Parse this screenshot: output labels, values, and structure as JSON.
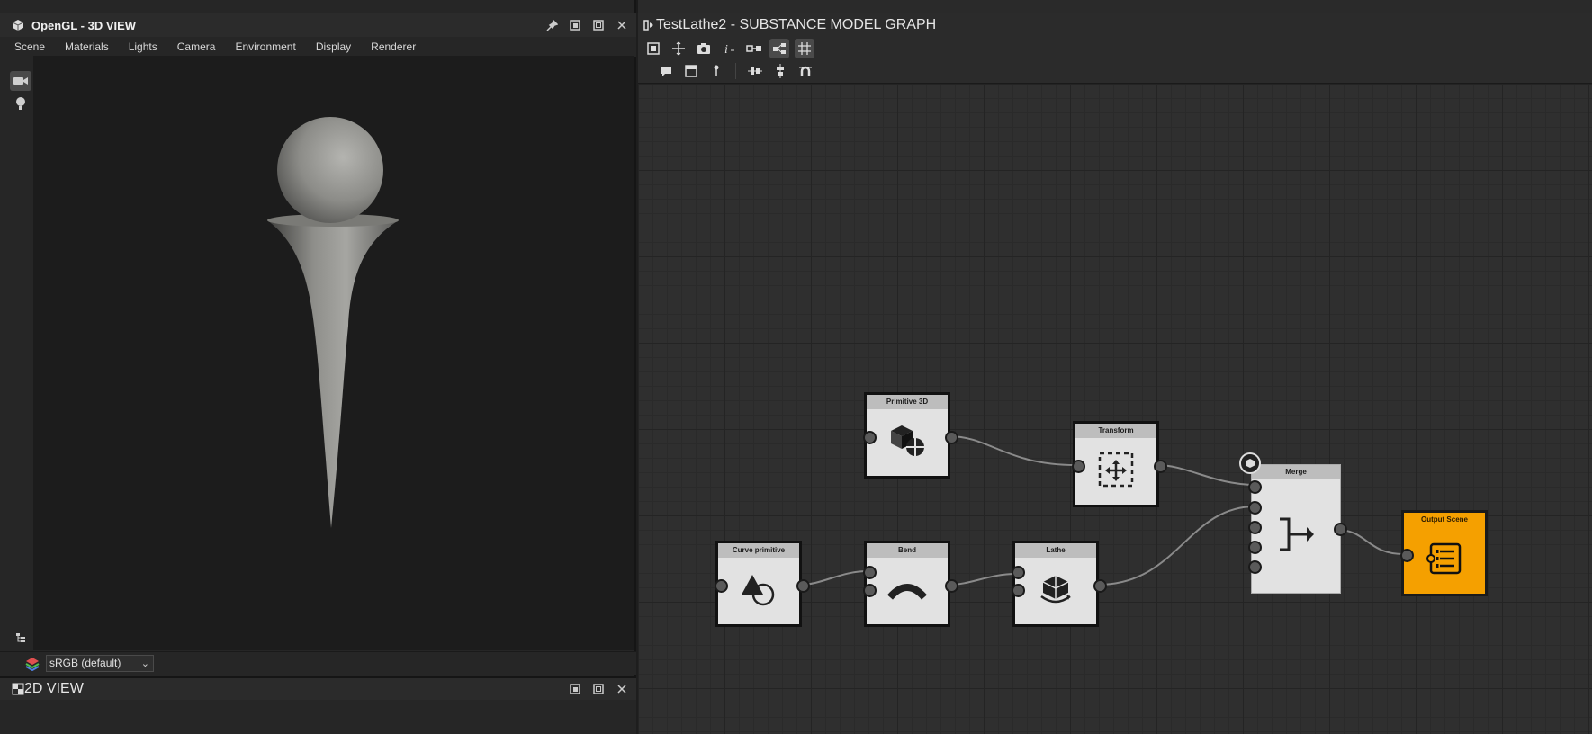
{
  "left_panel": {
    "title": "OpenGL - 3D VIEW",
    "menu": [
      "Scene",
      "Materials",
      "Lights",
      "Camera",
      "Environment",
      "Display",
      "Renderer"
    ],
    "colorspace": "sRGB (default)",
    "twod_title": "2D VIEW"
  },
  "right_panel": {
    "title": "TestLathe2 - SUBSTANCE MODEL GRAPH"
  },
  "nodes": {
    "primitive3d": "Primitive 3D",
    "transform": "Transform",
    "merge": "Merge",
    "output": "Output Scene",
    "curve": "Curve primitive",
    "bend": "Bend",
    "lathe": "Lathe"
  },
  "colors": {
    "output_node": "#f5a000",
    "node_body": "#e2e2e2",
    "panel_bg": "#262626"
  }
}
